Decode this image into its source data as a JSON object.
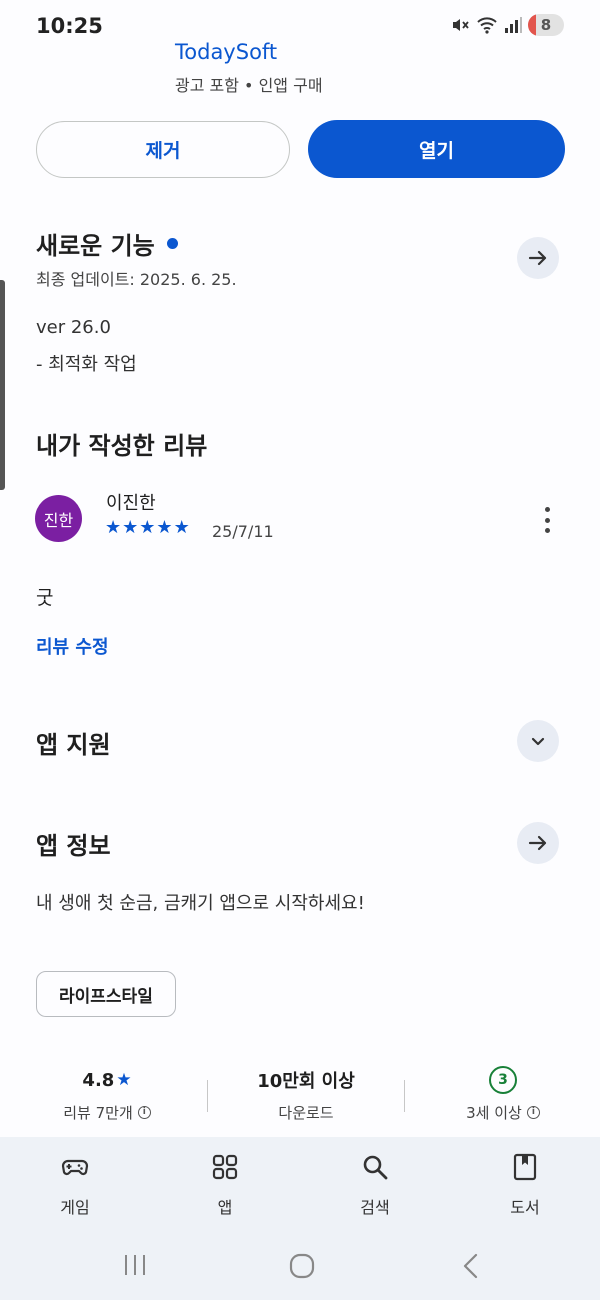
{
  "status_bar": {
    "time": "10:25",
    "battery": "8"
  },
  "app": {
    "developer": "TodaySoft",
    "meta": "광고 포함  •  인앱 구매"
  },
  "actions": {
    "remove_label": "제거",
    "open_label": "열기"
  },
  "whats_new": {
    "title": "새로운 기능",
    "last_update": "최종 업데이트: 2025. 6. 25.",
    "version": "ver 26.0",
    "change": "- 최적화 작업"
  },
  "my_review": {
    "title": "내가 작성한 리뷰",
    "avatar_text": "진한",
    "reviewer": "이진한",
    "stars": 5,
    "date": "25/7/11",
    "text": "굿",
    "edit_label": "리뷰 수정"
  },
  "support": {
    "title": "앱 지원"
  },
  "about": {
    "title": "앱 정보",
    "description": "내 생애 첫 순금, 금캐기 앱으로 시작하세요!",
    "category": "라이프스타일"
  },
  "stats": {
    "rating": "4.8",
    "rating_label": "리뷰 7만개",
    "downloads": "10만회 이상",
    "downloads_label": "다운로드",
    "age": "3",
    "age_label": "3세 이상"
  },
  "bottom_nav": {
    "items": [
      {
        "label": "게임",
        "icon": "gamepad-icon"
      },
      {
        "label": "앱",
        "icon": "apps-grid-icon"
      },
      {
        "label": "검색",
        "icon": "search-icon"
      },
      {
        "label": "도서",
        "icon": "book-icon"
      }
    ]
  },
  "colors": {
    "accent": "#0b57d0",
    "avatar": "#7b1fa2",
    "age_badge": "#188038"
  }
}
